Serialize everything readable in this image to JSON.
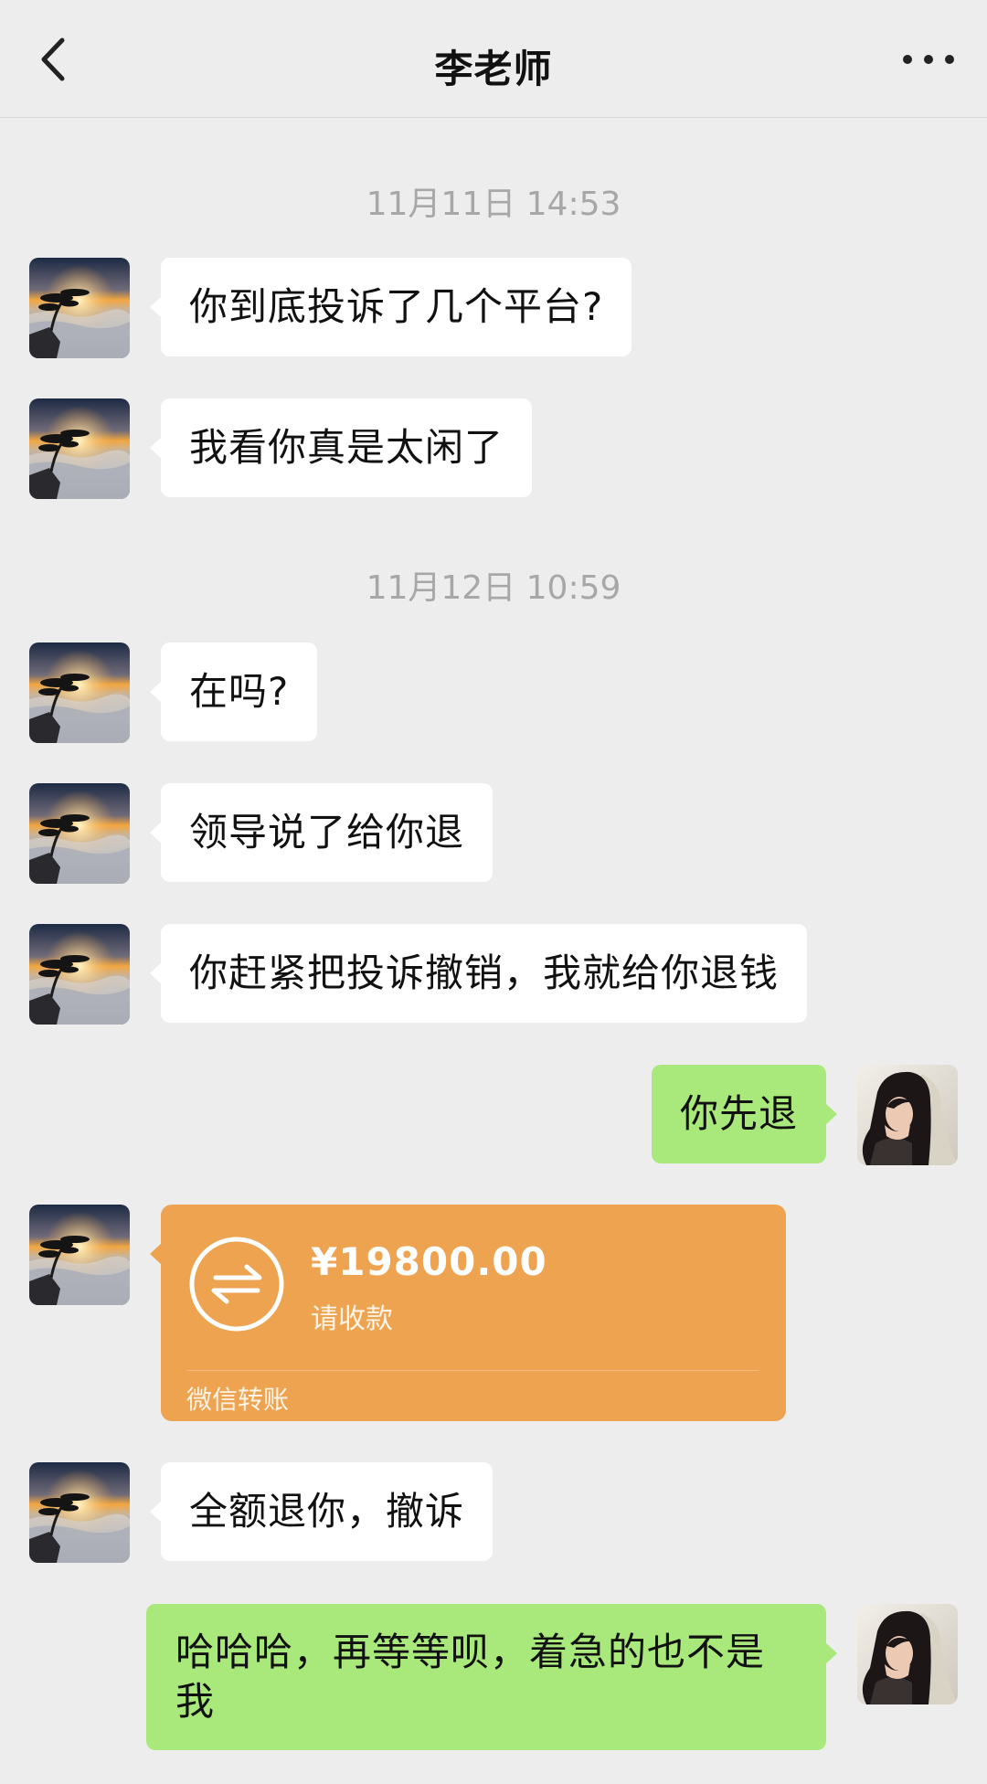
{
  "header": {
    "title": "李老师",
    "back_icon": "chevron-left-icon",
    "more_icon": "ellipsis-icon"
  },
  "messages": {
    "ts1": "11月11日 14:53",
    "m1": "你到底投诉了几个平台?",
    "m2": "我看你真是太闲了",
    "ts2": "11月12日 10:59",
    "m3": "在吗?",
    "m4": "领导说了给你退",
    "m5": "你赶紧把投诉撤销，我就给你退钱",
    "m6": "你先退",
    "transfer": {
      "amount": "¥19800.00",
      "status": "请收款",
      "footer": "微信转账",
      "icon": "transfer-arrows-icon",
      "color": "#eda350"
    },
    "m7": "全额退你，撤诉",
    "m8": "哈哈哈，再等等呗，着急的也不是我"
  },
  "colors": {
    "background": "#ededed",
    "incoming_bubble": "#ffffff",
    "outgoing_bubble": "#a9e97b",
    "timestamp": "#a7a7a7"
  }
}
